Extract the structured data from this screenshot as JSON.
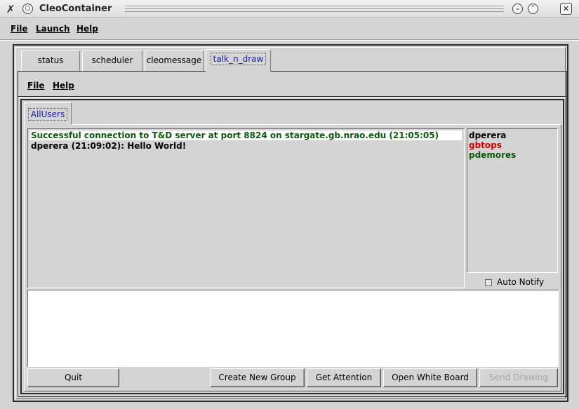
{
  "window": {
    "title": "CleoContainer",
    "app_icon": "x-tools-icon",
    "title_buttons": [
      "minimize-icon",
      "maximize-icon",
      "close-icon"
    ]
  },
  "menubar": {
    "file": "File",
    "launch": "Launch",
    "help": "Help"
  },
  "tabs": [
    {
      "label": "status",
      "active": false
    },
    {
      "label": "scheduler",
      "active": false
    },
    {
      "label": "cleomessage",
      "active": false
    },
    {
      "label": "talk_n_draw",
      "active": true
    }
  ],
  "inner_menubar": {
    "file": "File",
    "help": "Help"
  },
  "inner_tabs": [
    {
      "label": "AllUsers",
      "active": true
    }
  ],
  "messages": [
    {
      "text": "Successful connection to T&D server at port 8824 on stargate.gb.nrao.edu (21:05:05)",
      "color": "#0b5a0b",
      "highlight": true
    },
    {
      "text": "dperera (21:09:02): Hello World!",
      "color": "#000000",
      "highlight": false
    }
  ],
  "users": [
    {
      "name": "dperera",
      "color": "#000000"
    },
    {
      "name": "gbtops",
      "color": "#d00000"
    },
    {
      "name": "pdemores",
      "color": "#0b5a0b"
    }
  ],
  "auto_notify": {
    "label": "Auto Notify",
    "checked": false
  },
  "input": {
    "value": ""
  },
  "buttons": {
    "quit": "Quit",
    "create_group": "Create New Group",
    "get_attention": "Get Attention",
    "open_white_board": "Open White Board",
    "send_drawing": "Send Drawing"
  }
}
